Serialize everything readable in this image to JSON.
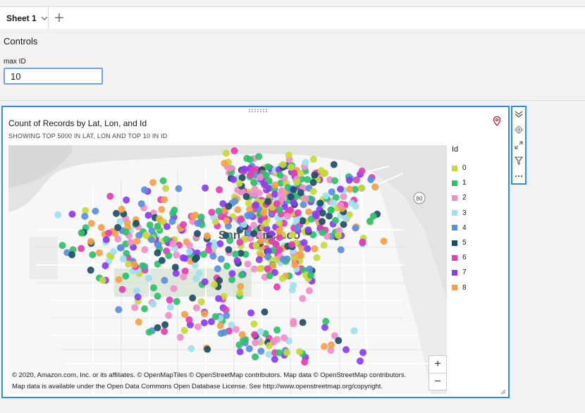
{
  "tabs": [
    {
      "label": "Sheet 1"
    }
  ],
  "controls": {
    "title": "Controls",
    "max_id": {
      "label": "max ID",
      "value": "10"
    }
  },
  "visual": {
    "title": "Count of Records by Lat, Lon, and Id",
    "subtitle": "SHOWING TOP 5000 IN LAT, LON AND TOP 10 IN ID",
    "map_label": "San Francisco",
    "highway_shield": "80",
    "zoom_in": "+",
    "zoom_out": "−",
    "attribution_line1": "© 2020, Amazon.com, Inc. or its affiliates. © OpenMapTiles © OpenStreetMap contributors. Map data © OpenStreetMap contributors.",
    "attribution_line2": "Map data is available under the Open Data Commons Open Database License. See http://www.openstreetmap.org/copyright."
  },
  "chart_data": {
    "type": "scatter",
    "title": "Count of Records by Lat, Lon, and Id",
    "subtitle": "SHOWING TOP 5000 IN LAT, LON AND TOP 10 IN ID",
    "legend_title": "Id",
    "legend_position": "right",
    "series": [
      {
        "name": "0",
        "color": "#c5d93a"
      },
      {
        "name": "1",
        "color": "#2ec06a"
      },
      {
        "name": "2",
        "color": "#f08ec8"
      },
      {
        "name": "3",
        "color": "#9fe0ee"
      },
      {
        "name": "4",
        "color": "#5b8ee0"
      },
      {
        "name": "5",
        "color": "#1f4e63"
      },
      {
        "name": "6",
        "color": "#e23fb0"
      },
      {
        "name": "7",
        "color": "#8a3cf0"
      },
      {
        "name": "8",
        "color": "#f4a24a"
      }
    ]
  },
  "toolbar": {
    "icons": [
      "collapse-icon",
      "gear-icon",
      "expand-icon",
      "filter-icon",
      "more-icon"
    ]
  },
  "colors": {
    "accent": "#2e8fd8",
    "input_border": "#6fa6d6",
    "pin": "#d0112b"
  }
}
